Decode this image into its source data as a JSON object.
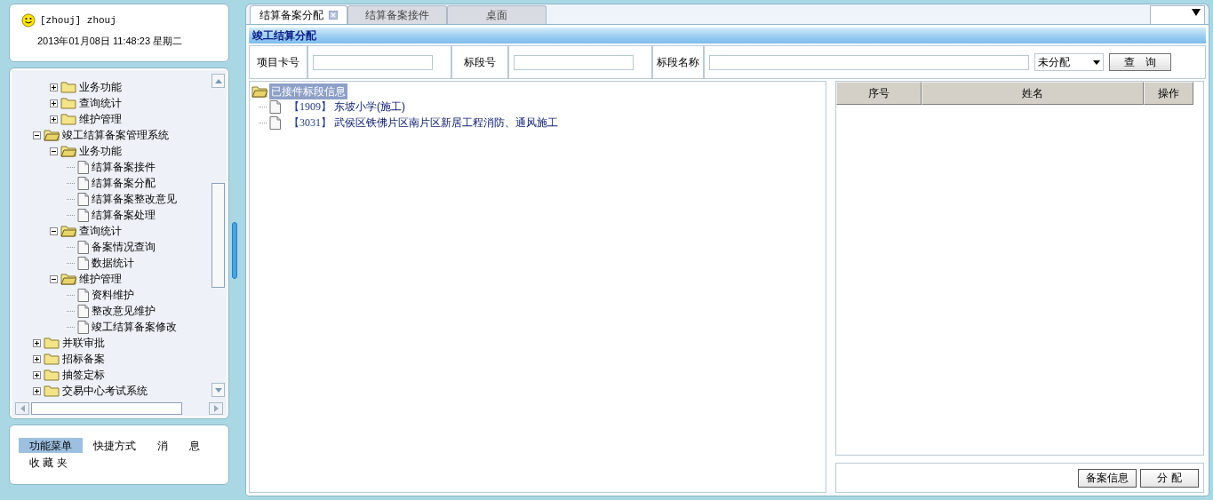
{
  "user": {
    "name": "[zhouj] zhouj",
    "datetime": "2013年01月08日 11:48:23 星期二"
  },
  "menu_tree": {
    "partial_children": [
      {
        "label": "业务功能",
        "expanded": false
      },
      {
        "label": "查询统计",
        "expanded": false
      },
      {
        "label": "维护管理",
        "expanded": false
      }
    ],
    "nodes": [
      {
        "label": "竣工结算备案管理系统",
        "expanded": true,
        "children": [
          {
            "label": "业务功能",
            "expanded": true,
            "children": [
              {
                "label": "结算备案接件"
              },
              {
                "label": "结算备案分配"
              },
              {
                "label": "结算备案整改意见"
              },
              {
                "label": "结算备案处理"
              }
            ]
          },
          {
            "label": "查询统计",
            "expanded": true,
            "children": [
              {
                "label": "备案情况查询"
              },
              {
                "label": "数据统计"
              }
            ]
          },
          {
            "label": "维护管理",
            "expanded": true,
            "children": [
              {
                "label": "资料维护"
              },
              {
                "label": "整改意见维护"
              },
              {
                "label": "竣工结算备案修改"
              }
            ]
          }
        ]
      },
      {
        "label": "并联审批",
        "expanded": false
      },
      {
        "label": "招标备案",
        "expanded": false
      },
      {
        "label": "抽签定标",
        "expanded": false
      },
      {
        "label": "交易中心考试系统",
        "expanded": false
      }
    ]
  },
  "bottom_tabs": [
    {
      "label": "功能菜单",
      "selected": true
    },
    {
      "label": "快捷方式",
      "selected": false
    },
    {
      "label": "消　　息",
      "selected": false
    },
    {
      "label": "收 藏 夹",
      "selected": false
    }
  ],
  "tabs": [
    {
      "label": "结算备案分配",
      "selected": true,
      "closable": true
    },
    {
      "label": "结算备案接件",
      "selected": false,
      "closable": false
    },
    {
      "label": "桌面",
      "selected": false,
      "closable": false
    }
  ],
  "panel_title": "竣工结算分配",
  "filters": [
    {
      "label": "项目卡号",
      "kind": "text"
    },
    {
      "label": "标段号",
      "kind": "text"
    },
    {
      "label": "标段名称",
      "kind": "wide"
    }
  ],
  "status_select": {
    "value": "未分配"
  },
  "query_button": "查　询",
  "section_tree": {
    "label": "已接件标段信息",
    "selected": true,
    "items": [
      {
        "code": "【1909】",
        "name": "东坡小学(施工)"
      },
      {
        "code": "【3031】",
        "name": "武侯区铁佛片区南片区新居工程消防、通风施工"
      }
    ]
  },
  "grid": {
    "columns": [
      "序号",
      "姓名",
      "操作"
    ]
  },
  "footer_buttons": [
    "备案信息",
    "分 配"
  ]
}
